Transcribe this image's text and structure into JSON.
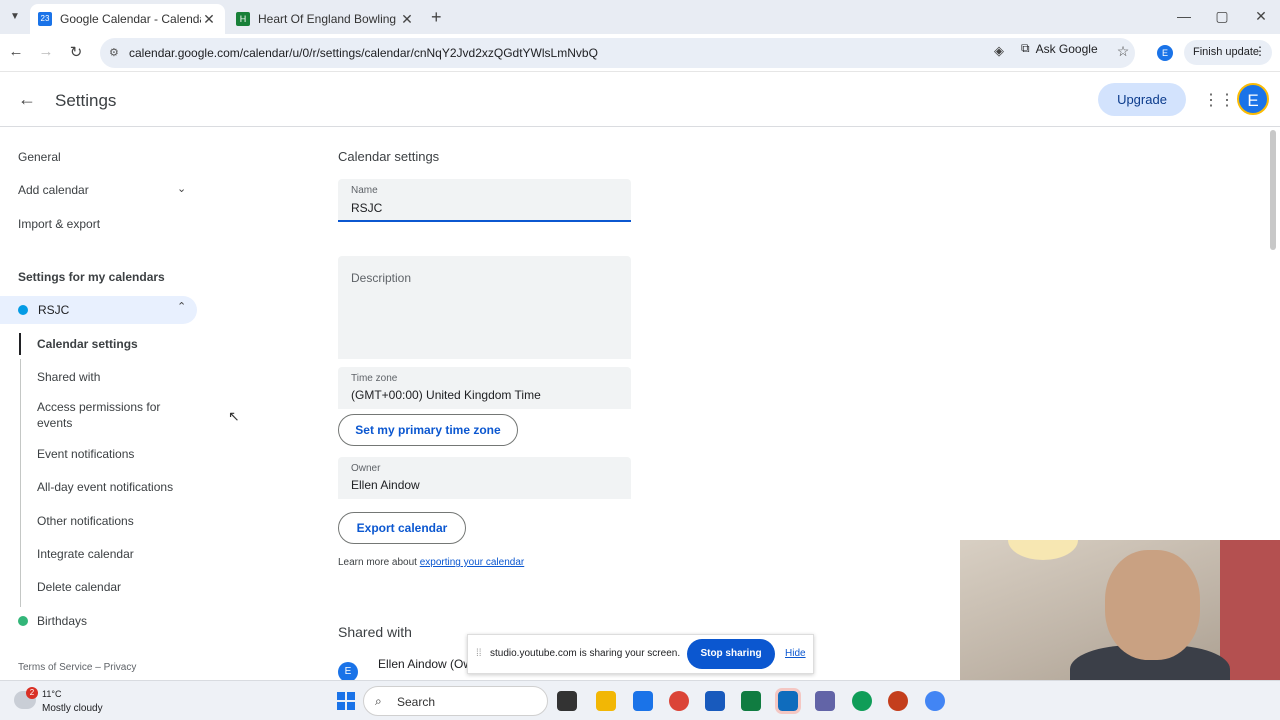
{
  "browser": {
    "tabs": [
      {
        "title": "Google Calendar - Calendar se",
        "favicon_text": "23",
        "color": "#1a73e8"
      },
      {
        "title": "Heart Of England Bowling Leag",
        "favicon_text": "H",
        "color": "#188038"
      }
    ],
    "url": "calendar.google.com/calendar/u/0/r/settings/calendar/cnNqY2Jvd2xzQGdtYWlsLmNvbQ",
    "ask_google": "Ask Google",
    "profile_initial": "E",
    "finish_update": "Finish update"
  },
  "appbar": {
    "title": "Settings",
    "upgrade": "Upgrade",
    "avatar_initial": "E"
  },
  "sidebar": {
    "general": "General",
    "add_calendar": "Add calendar",
    "import_export": "Import & export",
    "my_calendars_heading": "Settings for my calendars",
    "calendar_name": "RSJC",
    "calendar_color": "#039be5",
    "sub_items": [
      "Calendar settings",
      "Shared with",
      "Access permissions for events",
      "Event notifications",
      "All-day event notifications",
      "Other notifications",
      "Integrate calendar",
      "Delete calendar"
    ],
    "birthdays": "Birthdays",
    "birthdays_color": "#33b679",
    "footer": "Terms of Service – Privacy"
  },
  "main": {
    "section_title": "Calendar settings",
    "name_label": "Name",
    "name_value": "RSJC",
    "description_placeholder": "Description",
    "timezone_label": "Time zone",
    "timezone_value": "(GMT+00:00) United Kingdom Time",
    "set_primary_tz": "Set my primary time zone",
    "owner_label": "Owner",
    "owner_value": "Ellen Aindow",
    "export_button": "Export calendar",
    "learn_more_prefix": "Learn more about ",
    "learn_more_link": "exporting your calendar",
    "shared_with_title": "Shared with",
    "shared_person_initial": "E",
    "shared_person": "Ellen Aindow (Ow"
  },
  "share_bar": {
    "message": "studio.youtube.com is sharing your screen.",
    "stop": "Stop sharing",
    "hide": "Hide"
  },
  "taskbar": {
    "weather_badge": "2",
    "temperature": "11°C",
    "weather": "Mostly cloudy",
    "search": "Search"
  }
}
